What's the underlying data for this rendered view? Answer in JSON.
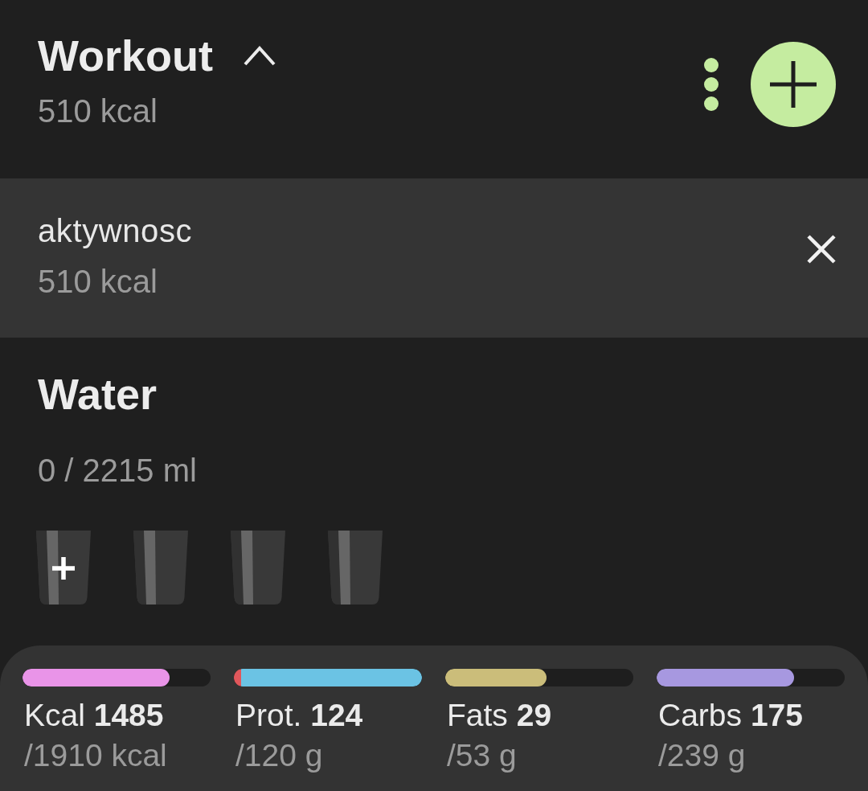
{
  "workout": {
    "title": "Workout",
    "expanded": true,
    "calories": "510 kcal",
    "entries": [
      {
        "name": "aktywnosc",
        "calories": "510 kcal"
      }
    ]
  },
  "water": {
    "title": "Water",
    "amount": "0 / 2215 ml",
    "glasses": [
      {
        "kind": "add"
      },
      {
        "kind": "empty"
      },
      {
        "kind": "empty"
      },
      {
        "kind": "empty"
      }
    ]
  },
  "macros": [
    {
      "label": "Kcal **1485**",
      "target": "/1910 kcal",
      "level": 0.78,
      "color": "#e994e8",
      "exceeded": false
    },
    {
      "label": "Prot. **124**",
      "target": "/120 g",
      "level": 1,
      "color": "#6bc3e4",
      "exceeded": true
    },
    {
      "label": "Fats **29**",
      "target": "/53 g",
      "level": 0.54,
      "color": "#cbbd7a",
      "exceeded": false
    },
    {
      "label": "Carbs **175**",
      "target": "/239 g",
      "level": 0.73,
      "color": "#a798e0",
      "exceeded": false
    }
  ]
}
